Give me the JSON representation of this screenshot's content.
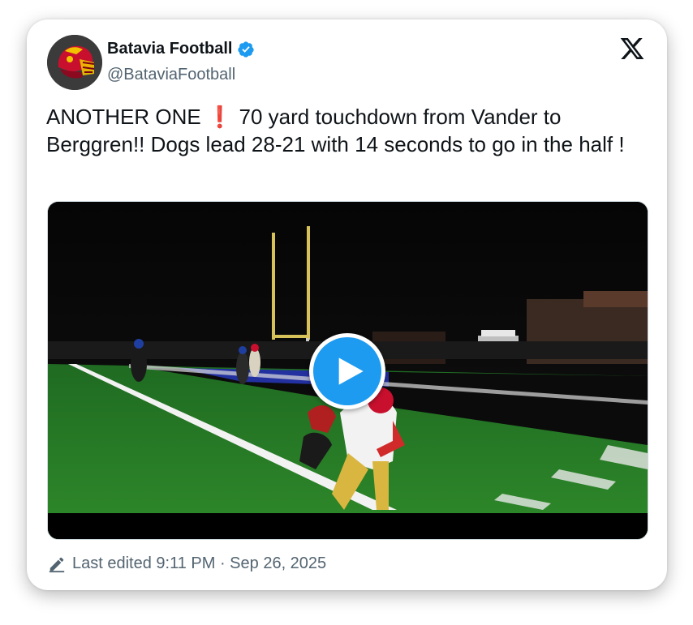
{
  "account": {
    "display_name": "Batavia Football",
    "handle": "@BataviaFootball",
    "verified": true,
    "avatar_icon": "helmet-logo-icon"
  },
  "brand": {
    "logo_icon": "x-logo-icon"
  },
  "tweet": {
    "text": "ANOTHER ONE ❗ 70 yard touchdown from Vander to Berggren!! Dogs lead 28-21 with 14 seconds to go in the half !"
  },
  "media": {
    "type": "video",
    "play_icon": "play-icon"
  },
  "footer": {
    "edited_icon": "pencil-icon",
    "edited_text": "Last edited 9:11 PM · Sep 26, 2025"
  },
  "colors": {
    "accent": "#1d9bf0",
    "text_primary": "#0f1419",
    "text_secondary": "#536471"
  }
}
